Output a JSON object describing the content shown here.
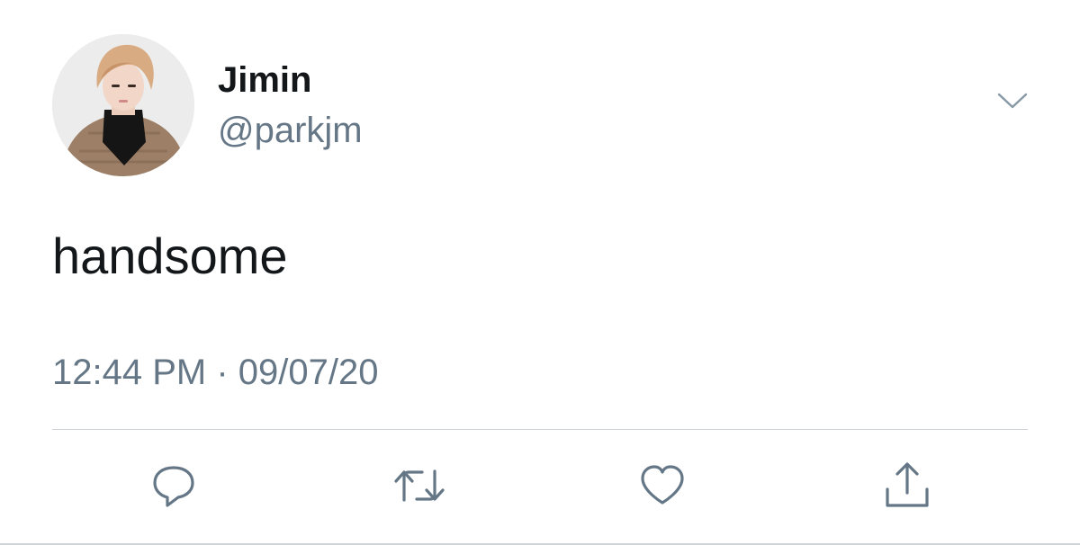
{
  "author": {
    "display_name": "Jimin",
    "handle": "@parkjm",
    "avatar_icon": "profile-photo"
  },
  "tweet": {
    "text": "handsome",
    "time": "12:44 PM",
    "separator": "·",
    "date": "09/07/20"
  },
  "actions": {
    "more_icon": "chevron-down-icon",
    "reply_icon": "reply-icon",
    "retweet_icon": "retweet-icon",
    "like_icon": "heart-icon",
    "share_icon": "share-icon"
  },
  "colors": {
    "text_primary": "#14171a",
    "text_secondary": "#657786",
    "icon": "#657786",
    "divider": "#cdd3d8"
  }
}
